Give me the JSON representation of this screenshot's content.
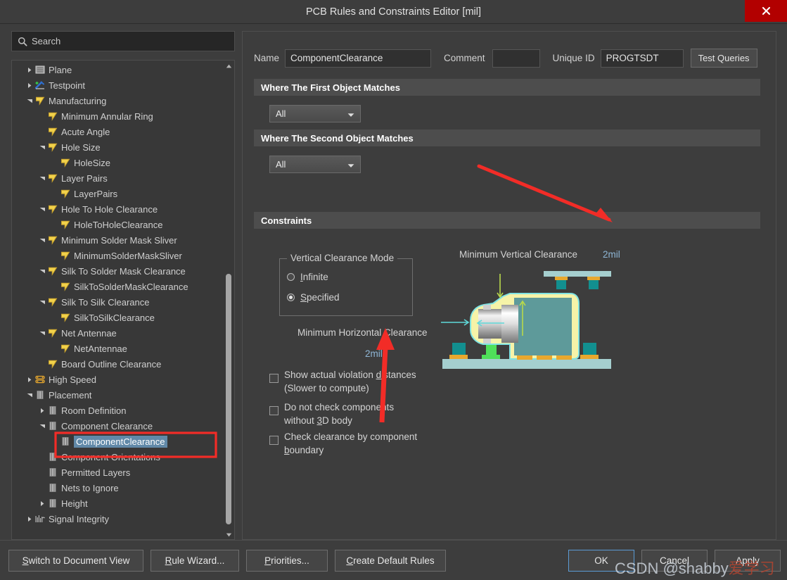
{
  "window": {
    "title": "PCB Rules and Constraints Editor [mil]",
    "close_label": "close-icon",
    "close_color": "#b20000"
  },
  "search": {
    "placeholder": "Search",
    "value": "",
    "icon": "search-icon"
  },
  "tree": {
    "items": [
      {
        "label": "Plane",
        "indent": 1,
        "icon": "plane-icon",
        "arrow": "collapsed",
        "selected": false
      },
      {
        "label": "Testpoint",
        "indent": 1,
        "icon": "testpoint-icon",
        "arrow": "collapsed",
        "selected": false
      },
      {
        "label": "Manufacturing",
        "indent": 1,
        "icon": "manufacturing-icon",
        "arrow": "expanded",
        "selected": false
      },
      {
        "label": "Minimum Annular Ring",
        "indent": 2,
        "icon": "manufacturing-icon",
        "arrow": "none",
        "selected": false
      },
      {
        "label": "Acute Angle",
        "indent": 2,
        "icon": "manufacturing-icon",
        "arrow": "none",
        "selected": false
      },
      {
        "label": "Hole Size",
        "indent": 2,
        "icon": "manufacturing-icon",
        "arrow": "expanded",
        "selected": false
      },
      {
        "label": "HoleSize",
        "indent": 3,
        "icon": "manufacturing-icon",
        "arrow": "none",
        "selected": false
      },
      {
        "label": "Layer Pairs",
        "indent": 2,
        "icon": "manufacturing-icon",
        "arrow": "expanded",
        "selected": false
      },
      {
        "label": "LayerPairs",
        "indent": 3,
        "icon": "manufacturing-icon",
        "arrow": "none",
        "selected": false
      },
      {
        "label": "Hole To Hole Clearance",
        "indent": 2,
        "icon": "manufacturing-icon",
        "arrow": "expanded",
        "selected": false
      },
      {
        "label": "HoleToHoleClearance",
        "indent": 3,
        "icon": "manufacturing-icon",
        "arrow": "none",
        "selected": false
      },
      {
        "label": "Minimum Solder Mask Sliver",
        "indent": 2,
        "icon": "manufacturing-icon",
        "arrow": "expanded",
        "selected": false
      },
      {
        "label": "MinimumSolderMaskSliver",
        "indent": 3,
        "icon": "manufacturing-icon",
        "arrow": "none",
        "selected": false
      },
      {
        "label": "Silk To Solder Mask Clearance",
        "indent": 2,
        "icon": "manufacturing-icon",
        "arrow": "expanded",
        "selected": false
      },
      {
        "label": "SilkToSolderMaskClearance",
        "indent": 3,
        "icon": "manufacturing-icon",
        "arrow": "none",
        "selected": false
      },
      {
        "label": "Silk To Silk Clearance",
        "indent": 2,
        "icon": "manufacturing-icon",
        "arrow": "expanded",
        "selected": false
      },
      {
        "label": "SilkToSilkClearance",
        "indent": 3,
        "icon": "manufacturing-icon",
        "arrow": "none",
        "selected": false
      },
      {
        "label": "Net Antennae",
        "indent": 2,
        "icon": "manufacturing-icon",
        "arrow": "expanded",
        "selected": false
      },
      {
        "label": "NetAntennae",
        "indent": 3,
        "icon": "manufacturing-icon",
        "arrow": "none",
        "selected": false
      },
      {
        "label": "Board Outline Clearance",
        "indent": 2,
        "icon": "manufacturing-icon",
        "arrow": "none",
        "selected": false
      },
      {
        "label": "High Speed",
        "indent": 1,
        "icon": "highspeed-icon",
        "arrow": "collapsed",
        "selected": false
      },
      {
        "label": "Placement",
        "indent": 1,
        "icon": "placement-icon",
        "arrow": "expanded",
        "selected": false
      },
      {
        "label": "Room Definition",
        "indent": 2,
        "icon": "placement-icon",
        "arrow": "collapsed",
        "selected": false
      },
      {
        "label": "Component Clearance",
        "indent": 2,
        "icon": "placement-icon",
        "arrow": "expanded",
        "selected": false
      },
      {
        "label": "ComponentClearance",
        "indent": 3,
        "icon": "placement-icon",
        "arrow": "none",
        "selected": true
      },
      {
        "label": "Component Orientations",
        "indent": 2,
        "icon": "placement-icon",
        "arrow": "none",
        "selected": false
      },
      {
        "label": "Permitted Layers",
        "indent": 2,
        "icon": "placement-icon",
        "arrow": "none",
        "selected": false
      },
      {
        "label": "Nets to Ignore",
        "indent": 2,
        "icon": "placement-icon",
        "arrow": "none",
        "selected": false
      },
      {
        "label": "Height",
        "indent": 2,
        "icon": "placement-icon",
        "arrow": "collapsed",
        "selected": false
      },
      {
        "label": "Signal Integrity",
        "indent": 1,
        "icon": "signalintegrity-icon",
        "arrow": "collapsed",
        "selected": false
      }
    ]
  },
  "header": {
    "name_label": "Name",
    "name_value": "ComponentClearance",
    "comment_label": "Comment",
    "comment_value": "",
    "unique_id_label": "Unique ID",
    "unique_id_value": "PROGTSDT",
    "test_queries_label": "Test Queries"
  },
  "sections": {
    "first_object": "Where The First Object Matches",
    "second_object": "Where The Second Object Matches",
    "constraints": "Constraints"
  },
  "scope": {
    "first_value": "All",
    "second_value": "All"
  },
  "constraints": {
    "vertical_mode_legend": "Vertical Clearance Mode",
    "radio_infinite": "Infinite",
    "radio_infinite_selected": false,
    "radio_specified": "Specified",
    "radio_specified_selected": true,
    "min_horizontal_label": "Minimum Horizontal Clearance",
    "min_horizontal_value": "2mil",
    "checkboxes": [
      {
        "label": "Show actual violation distances (Slower to compute)",
        "checked": false
      },
      {
        "label": "Do not check components without 3D body",
        "checked": false
      },
      {
        "label": "Check clearance by component boundary",
        "checked": false
      }
    ],
    "illustration_label": "Minimum Vertical Clearance",
    "illustration_value": "2mil"
  },
  "footer": {
    "switch_label": "Switch to Document View",
    "wizard_label": "Rule Wizard...",
    "priorities_label": "Priorities...",
    "create_default_label": "Create Default Rules",
    "ok_label": "OK",
    "cancel_label": "Cancel",
    "apply_label": "Apply"
  },
  "watermark": {
    "text_latin": "CSDN @shabby",
    "text_cn": "爱学习"
  },
  "colors": {
    "accent_blue": "#6189a8",
    "value_blue": "#8fb7d6",
    "annotation_red": "#f22c27",
    "close_red": "#b20000",
    "panel_bg": "#3d3d3d",
    "section_bar": "#4d4d4d"
  }
}
